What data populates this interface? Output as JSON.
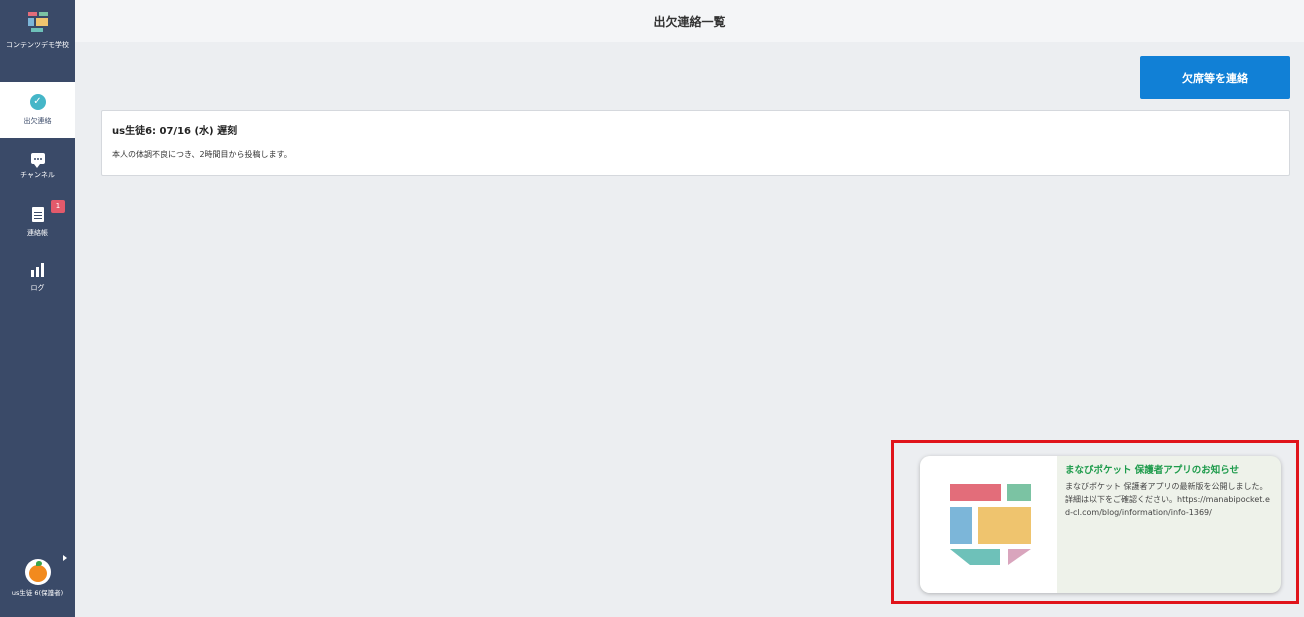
{
  "sidebar": {
    "brand_label": "コンテンツデモ学校",
    "items": [
      {
        "label": "出欠連絡",
        "icon": "check-circle-icon",
        "active": true
      },
      {
        "label": "チャンネル",
        "icon": "chat-icon"
      },
      {
        "label": "連絡帳",
        "icon": "document-icon",
        "badge": "1"
      },
      {
        "label": "ログ",
        "icon": "bar-chart-icon"
      }
    ],
    "user_name": "us生徒 6(保護者)"
  },
  "header": {
    "title": "出欠連絡一覧"
  },
  "actions": {
    "report_button": "欠席等を連絡"
  },
  "attendance_list": [
    {
      "title": "us生徒6: 07/16 (水) 遅刻",
      "body": "本人の体調不良につき、2時間目から投稿します。"
    }
  ],
  "notification": {
    "title": "まなびポケット 保護者アプリのお知らせ",
    "body": "まなびポケット 保護者アプリの最新版を公開しました。詳細は以下をご確認ください。https://manabipocket.ed-cl.com/blog/information/info-1369/"
  },
  "colors": {
    "sidebar": "#3a4a68",
    "primary_button": "#1180d6",
    "highlight_border": "#e0141b",
    "notif_title": "#1d9b4b"
  }
}
